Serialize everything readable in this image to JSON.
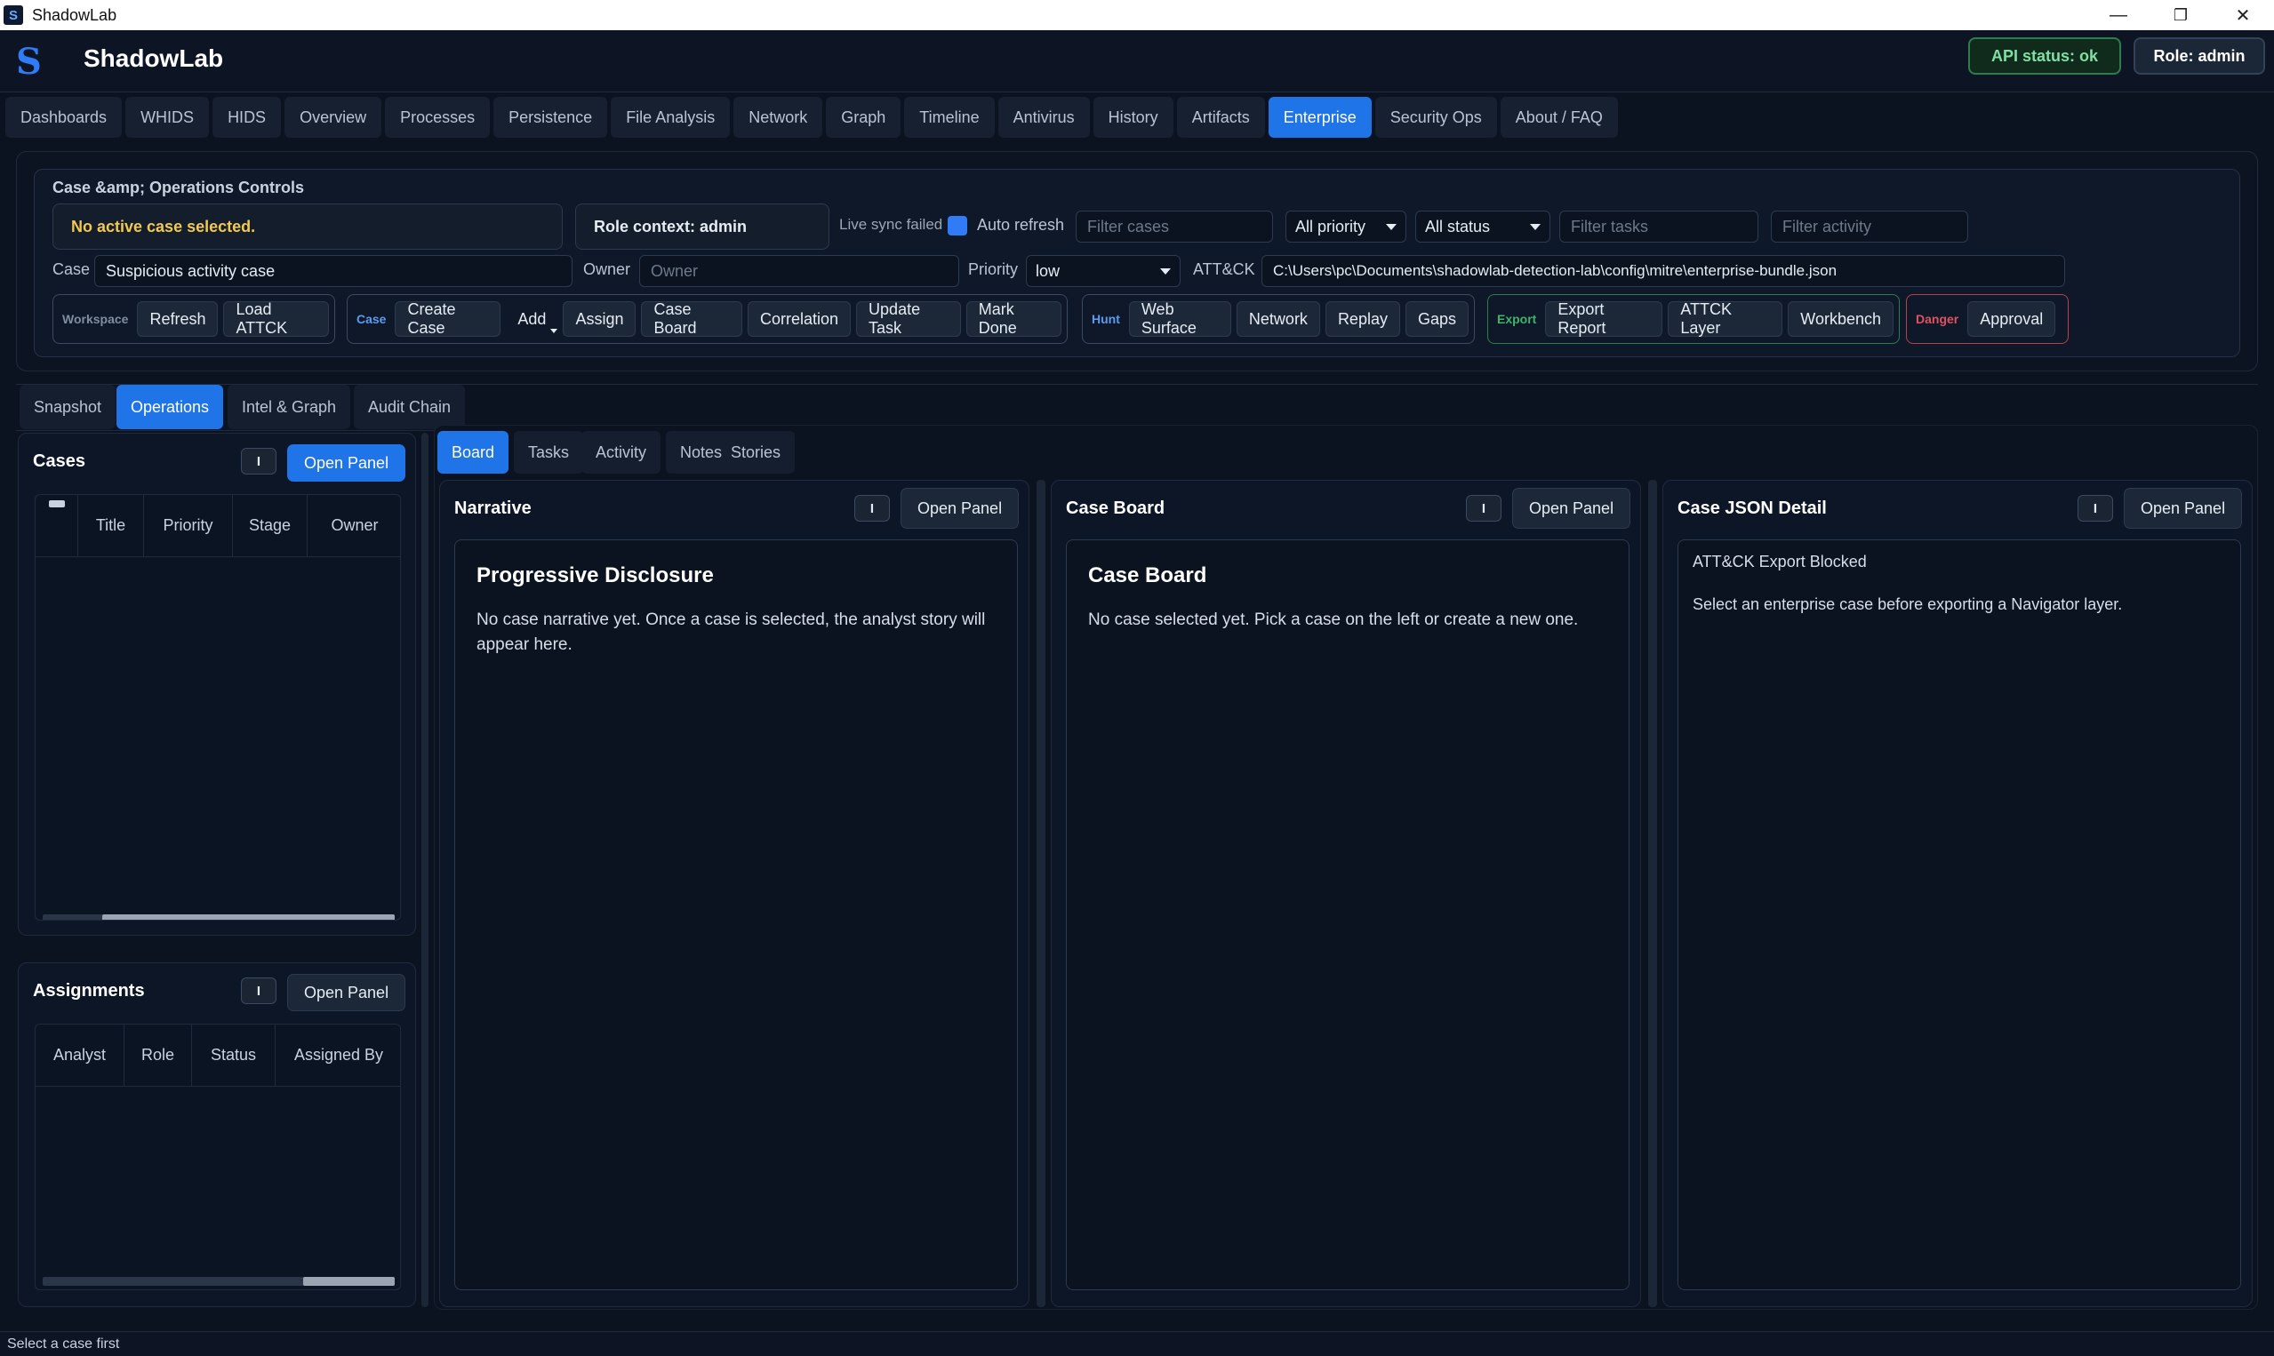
{
  "window": {
    "title": "ShadowLab",
    "app_icon": "S",
    "minimize": "—",
    "restore": "❐",
    "close": "✕"
  },
  "header": {
    "logo_letter": "S",
    "brand": "ShadowLab",
    "api_status": "API status: ok",
    "role": "Role: admin"
  },
  "main_tabs": [
    "Dashboards",
    "WHIDS",
    "HIDS",
    "Overview",
    "Processes",
    "Persistence",
    "File Analysis",
    "Network",
    "Graph",
    "Timeline",
    "Antivirus",
    "History",
    "Artifacts",
    "Enterprise",
    "Security Ops",
    "About / FAQ"
  ],
  "controls": {
    "title": "Case &amp; Operations Controls",
    "no_case": "No active case selected.",
    "role_context": "Role context: admin",
    "live_sync": "Live sync failed",
    "auto_refresh": "Auto refresh",
    "filter_cases_ph": "Filter cases",
    "priority_filter": "All priority",
    "status_filter": "All status",
    "filter_tasks_ph": "Filter tasks",
    "filter_activity_ph": "Filter activity",
    "case_label": "Case",
    "case_value": "Suspicious activity case",
    "owner_label": "Owner",
    "owner_ph": "Owner",
    "priority_label": "Priority",
    "priority_value": "low",
    "attck_label": "ATT&CK",
    "attck_path": "C:\\Users\\pc\\Documents\\shadowlab-detection-lab\\config\\mitre\\enterprise-bundle.json",
    "groups": {
      "workspace": {
        "tag": "Workspace",
        "color": "#7f8da0",
        "buttons": [
          "Refresh",
          "Load ATTCK"
        ]
      },
      "case": {
        "tag": "Case",
        "color": "#5b9bf0",
        "buttons": [
          "Create Case",
          "Add",
          "Assign",
          "Case Board",
          "Correlation",
          "Update Task",
          "Mark Done"
        ]
      },
      "hunt": {
        "tag": "Hunt",
        "color": "#5b9bf0",
        "buttons": [
          "Web Surface",
          "Network",
          "Replay",
          "Gaps"
        ]
      },
      "export": {
        "tag": "Export",
        "color": "#3fb36b",
        "buttons": [
          "Export Report",
          "ATTCK Layer",
          "Workbench"
        ]
      },
      "danger": {
        "tag": "Danger",
        "color": "#e0525e",
        "buttons": [
          "Approval"
        ]
      }
    }
  },
  "sub_tabs": [
    "Snapshot",
    "Operations",
    "Intel & Graph",
    "Audit Chain"
  ],
  "cases_panel": {
    "title": "Cases",
    "info": "I",
    "open": "Open Panel",
    "columns": [
      "",
      "Title",
      "Priority",
      "Stage",
      "Owner"
    ],
    "scroll_fraction": 0.17
  },
  "assignments_panel": {
    "title": "Assignments",
    "info": "I",
    "open": "Open Panel",
    "columns": [
      "Analyst",
      "Role",
      "Status",
      "Assigned By"
    ],
    "scroll_fraction": 0.74
  },
  "board_tabs": [
    "Board",
    "Tasks",
    "Activity",
    "Notes  Stories"
  ],
  "narrative": {
    "title": "Narrative",
    "info": "I",
    "open": "Open Panel",
    "heading": "Progressive Disclosure",
    "body": "No case narrative yet. Once a case is selected, the analyst story will appear here."
  },
  "case_board": {
    "title": "Case Board",
    "info": "I",
    "open": "Open Panel",
    "heading": "Case Board",
    "body": "No case selected yet. Pick a case on the left or create a new one."
  },
  "case_json": {
    "title": "Case JSON Detail",
    "info": "I",
    "open": "Open Panel",
    "line1": "ATT&CK Export Blocked",
    "line2": "Select an enterprise case before exporting a Navigator layer."
  },
  "status_bar": "Select a case first"
}
